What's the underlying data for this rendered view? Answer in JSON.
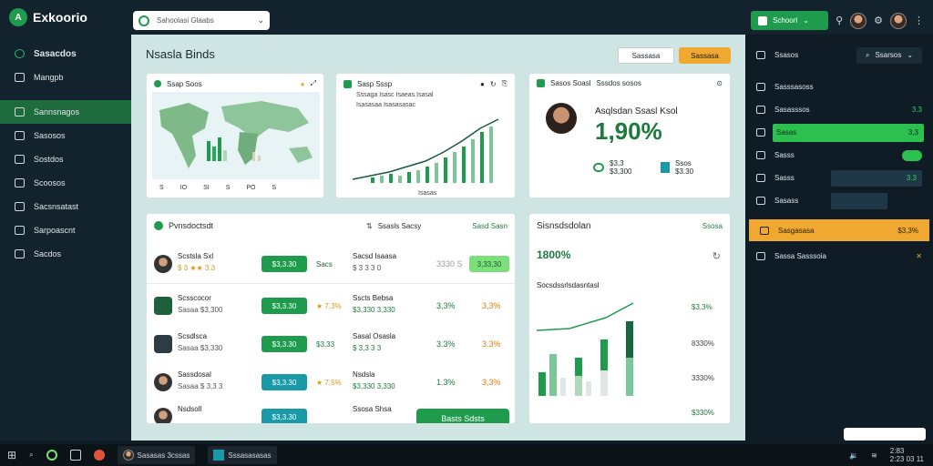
{
  "app": {
    "title": "Exkoorio"
  },
  "search": {
    "placeholder": "Sahoolasi Glaabs"
  },
  "topbar": {
    "action_label": "Schoorl",
    "time": "2:83",
    "date": "2:23 03 11"
  },
  "sidebar": {
    "items": [
      {
        "label": "Sasacdos",
        "icon": "leaf-icon"
      },
      {
        "label": "Mangpb",
        "icon": "grid-icon"
      },
      {
        "label": "Sannsnagos",
        "icon": "chart-icon",
        "active": true
      },
      {
        "label": "Sasosos",
        "icon": "folder-icon"
      },
      {
        "label": "Sostdos",
        "icon": "tag-icon"
      },
      {
        "label": "Scoosos",
        "icon": "doc-icon"
      },
      {
        "label": "Sacsnsatast",
        "icon": "list-icon"
      },
      {
        "label": "Sarpoascnt",
        "icon": "bird-icon"
      },
      {
        "label": "Sacdos",
        "icon": "book-icon"
      }
    ]
  },
  "main": {
    "title": "Nsasla Binds",
    "btn_secondary": "Sassasa",
    "btn_primary": "Sassasa",
    "map_card": {
      "title": "Ssap Soos",
      "labels": [
        "S",
        "IO",
        "SI",
        "S",
        "PO",
        "S"
      ]
    },
    "chart_card": {
      "title": "Sasp Sssp",
      "subtitle1": "Sssaga Isasc Isaeas Isasal",
      "subtitle2": "Isasasaa Isasasasac",
      "xlabel": "Isasas"
    },
    "profile_card": {
      "tab": "Sasos Soasl",
      "tag": "Sssdos sosos",
      "name": "Asqlsdan Ssasl Ksol",
      "pct": "1,90%",
      "stat1": "$3,300",
      "stat1_label": "$3,3",
      "stat2": "$3.30",
      "stat2_label": "Ssos"
    },
    "list_card": {
      "title": "Pvnsdoctsdt",
      "col_a": "Ssasls Sacsy",
      "col_b": "Sasd Sasn",
      "rows": [
        {
          "name": "Scstsla Sxl",
          "sub": "$ 3 ★★ 3.3",
          "pill": "$3,3.30",
          "pill_color": "#1e9b4d",
          "mid": "Sacs",
          "lbl": "Sacsd Isaasa",
          "val": "$ 3 3 3 0",
          "p1": "3330 S",
          "p2": "3,33,30"
        },
        {
          "name": "Scsscocor",
          "sub": "Sasaa $3,300",
          "pill": "$3,3.30",
          "pill_color": "#1e9b4d",
          "mid": "★ 7,3%",
          "lbl": "Sscts Bebsa",
          "val": "$3,330 3,330",
          "p1": "3,3%",
          "p2": "3,3%"
        },
        {
          "name": "Scsdlsca",
          "sub": "Sasaa $3,330",
          "pill": "$3,3.30",
          "pill_color": "#1e9b4d",
          "mid": "$3,33",
          "lbl": "Sasal Osasla",
          "val": "$ 3,3 3 3",
          "p1": "3.3%",
          "p2": "3.3%"
        },
        {
          "name": "Sassdosal",
          "sub": "Sasaa $ 3,3 3",
          "pill": "$3,3.30",
          "pill_color": "#1a9aa8",
          "mid": "★ 7,5%",
          "lbl": "Nsdsla",
          "val": "$3,330 3,330",
          "p1": "1.3%",
          "p2": "3,3%"
        },
        {
          "name": "Nsdsoll",
          "sub": "",
          "pill": "$3,3.30",
          "pill_color": "#1a9aa8",
          "mid": "",
          "lbl": "Ssosa Shsa",
          "val": "",
          "p1": "",
          "p2": ""
        }
      ],
      "cta": "Basts Sdsts"
    },
    "stats_card": {
      "title": "Sisnsdsdolan",
      "tag": "Ssosa",
      "big": "1800%",
      "subtitle": "Socsdssrlsdasntasl",
      "right_vals": [
        "$3,3%",
        "8330%",
        "3330%",
        "$330%"
      ]
    }
  },
  "right_panel": {
    "title": "Ssasos",
    "filter": "Ssarsos",
    "items": [
      {
        "label": "Sasssasoss",
        "val": ""
      },
      {
        "label": "Sasasssos",
        "val": "3.3"
      },
      {
        "label": "Sasas",
        "val": "3,3",
        "highlight": "green"
      },
      {
        "label": "Sasss",
        "val": ""
      },
      {
        "label": "Sasss",
        "val": "3.3"
      },
      {
        "label": "Sasass",
        "val": ""
      },
      {
        "label": "Sasgasasa",
        "val": "$3,3%",
        "highlight": "orange"
      },
      {
        "label": "Sassa Sasssoia",
        "val": ""
      }
    ]
  },
  "taskbar": {
    "app1": "Sasasas 3cssas",
    "app2": "Sssasasasas"
  },
  "colors": {
    "brand": "#1e9b4d",
    "accent": "#f0a930",
    "teal": "#1a9aa8"
  }
}
